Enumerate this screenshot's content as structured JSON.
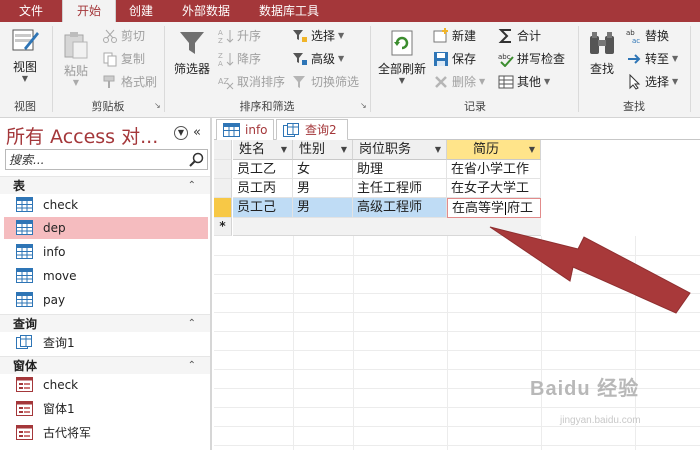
{
  "colors": {
    "accent": "#a4373a",
    "selection": "#f5bcbf",
    "row_highlight": "#bfdcf5",
    "header_sorted": "#ffe48a",
    "arrow": "#a8393a"
  },
  "tabs": {
    "file": "文件",
    "items": [
      {
        "label": "开始",
        "active": true
      },
      {
        "label": "创建"
      },
      {
        "label": "外部数据"
      },
      {
        "label": "数据库工具"
      }
    ]
  },
  "ribbon": {
    "view": {
      "button": "视图",
      "group": "视图"
    },
    "clipboard": {
      "paste": "粘贴",
      "cut": "剪切",
      "copy": "复制",
      "format_painter": "格式刷",
      "group": "剪贴板"
    },
    "sort_filter": {
      "filter": "筛选器",
      "ascending": "升序",
      "descending": "降序",
      "remove_sort": "取消排序",
      "selection": "选择",
      "advanced": "高级",
      "toggle_filter": "切换筛选",
      "group": "排序和筛选"
    },
    "records": {
      "refresh_all": "全部刷新",
      "new": "新建",
      "save": "保存",
      "delete": "删除",
      "totals": "合计",
      "spelling": "拼写检查",
      "more": "其他",
      "group": "记录"
    },
    "find": {
      "find": "查找",
      "replace": "替换",
      "goto": "转至",
      "select": "选择",
      "group": "查找"
    }
  },
  "nav": {
    "title": "所有 Access 对...",
    "search_placeholder": "搜索...",
    "sections": [
      {
        "label": "表",
        "items": [
          "check",
          "dep",
          "info",
          "move",
          "pay"
        ]
      },
      {
        "label": "查询",
        "items": [
          "查询1"
        ]
      },
      {
        "label": "窗体",
        "items": [
          "check",
          "窗体1",
          "古代将军"
        ]
      }
    ],
    "selected_item": "dep"
  },
  "doc_tabs": [
    {
      "label": "info",
      "active": false
    },
    {
      "label": "查询2",
      "active": true
    }
  ],
  "datasheet": {
    "columns": [
      "姓名",
      "性别",
      "岗位职务",
      "简历"
    ],
    "rows": [
      [
        "员工乙",
        "女",
        "助理",
        "在省小学工作"
      ],
      [
        "员工丙",
        "男",
        "主任工程师",
        "在女子大学工"
      ],
      [
        "员工己",
        "男",
        "高级工程师",
        "在高等学府工"
      ]
    ],
    "new_row_marker": "*"
  },
  "watermark": {
    "brand": "Baidu 经验",
    "url": "jingyan.baidu.com"
  }
}
